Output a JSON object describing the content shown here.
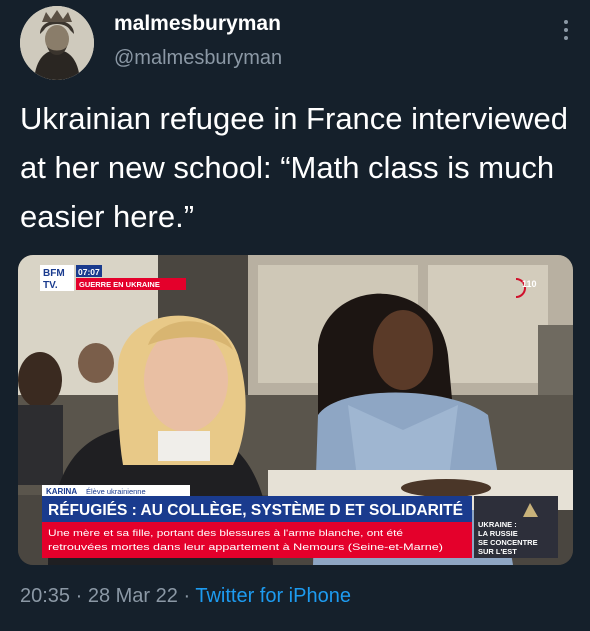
{
  "user": {
    "display_name": "malmesburyman",
    "handle": "@malmesburyman"
  },
  "tweet": {
    "text": "Ukrainian refugee in France interviewed at her new school: “Math class is much easier here.”",
    "time": "20:35",
    "separator": " · ",
    "date": "28 Mar 22",
    "source": "Twitter for iPhone"
  },
  "media": {
    "channel_logo_top": "BFM",
    "channel_logo_bottom": "TV.",
    "time_badge": "07:07",
    "program_tag": "GUERRE EN UKRAINE",
    "channel_number": "110",
    "person_name": "KARINA",
    "person_role": "Élève ukrainienne",
    "headline": "RÉFUGIÉS : AU COLLÈGE, SYSTÈME D ET SOLIDARITÉ",
    "ticker_line1": "Une mère et sa fille, portant des blessures à l'arme blanche, ont été",
    "ticker_line2": "retrouvées mortes dans leur appartement à Nemours (Seine-et-Marne)",
    "side_line1": "UKRAINE :",
    "side_line2": "LA RUSSIE",
    "side_line3": "SE CONCENTRE",
    "side_line4": "SUR L'EST"
  },
  "colors": {
    "background": "#15202b",
    "secondary_text": "#8b98a5",
    "link": "#1d9bf0",
    "bfm_red": "#e4002b",
    "bfm_blue": "#1a3b8e"
  },
  "icons": [
    "avatar-portrait",
    "more-options-icon"
  ]
}
